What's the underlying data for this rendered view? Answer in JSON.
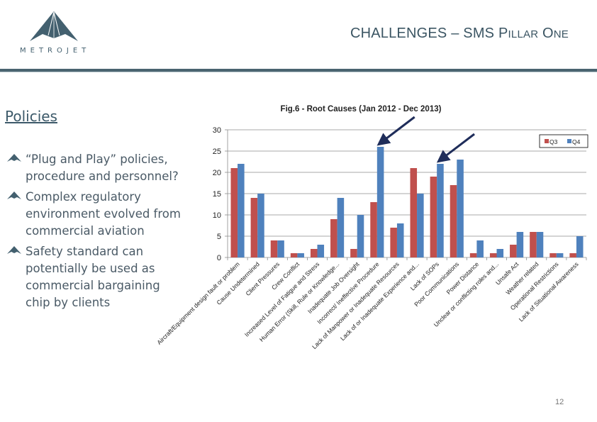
{
  "header": {
    "logo_text": "METROJET",
    "title_main": "CHALLENGES – SMS P",
    "title_sc1": "ILLAR",
    "title_mid": " O",
    "title_sc2": "NE"
  },
  "section": {
    "title": "Policies",
    "bullets": [
      "“Plug and Play” policies, procedure and personnel?",
      "Complex regulatory environment evolved from commercial aviation",
      "Safety standard can potentially be used as commercial bargaining chip by clients"
    ]
  },
  "footer": {
    "page_number": "12"
  },
  "colors": {
    "q3": "#c0504d",
    "q4": "#4f81bd",
    "accent": "#4a6470",
    "arrow": "#1f2d5a"
  },
  "chart_data": {
    "type": "bar",
    "title": "Fig.6 - Root Causes (Jan 2012 - Dec 2013)",
    "xlabel": "",
    "ylabel": "",
    "ylim": [
      0,
      30
    ],
    "yticks": [
      0,
      5,
      10,
      15,
      20,
      25,
      30
    ],
    "grid": true,
    "legend_position": "top-right",
    "categories": [
      "Aircraft/Equipment design fault or problem",
      "Cause Undetermined",
      "Client Pressures",
      "Crew Conflict",
      "Increased Level of Fatigue and Stress",
      "Human Error (Skill, Rule or Knowledge...",
      "Inadequate Job Oversight",
      "Incorrect/ Ineffective Procedure",
      "Lack of Manpower or Inadequate Resources",
      "Lack of or Inadequate Experience and...",
      "Lack of SOPs",
      "Poor Communications",
      "Power Distance",
      "Unclear or conflicting roles and...",
      "Unsafe Act",
      "Weather related",
      "Operational Restrictions",
      "Lack of Situational Awareness"
    ],
    "series": [
      {
        "name": "Q3",
        "values": [
          21,
          14,
          4,
          1,
          2,
          9,
          2,
          13,
          7,
          21,
          19,
          17,
          1,
          1,
          3,
          6,
          1,
          1
        ]
      },
      {
        "name": "Q4",
        "values": [
          22,
          15,
          4,
          1,
          3,
          14,
          10,
          26,
          8,
          15,
          22,
          23,
          4,
          2,
          6,
          6,
          1,
          5
        ]
      }
    ],
    "annotations": [
      {
        "type": "arrow",
        "points_to_category": "Incorrect/ Ineffective Procedure",
        "series": "Q4"
      },
      {
        "type": "arrow",
        "points_to_category": "Lack of SOPs",
        "series": "Q4"
      }
    ]
  }
}
